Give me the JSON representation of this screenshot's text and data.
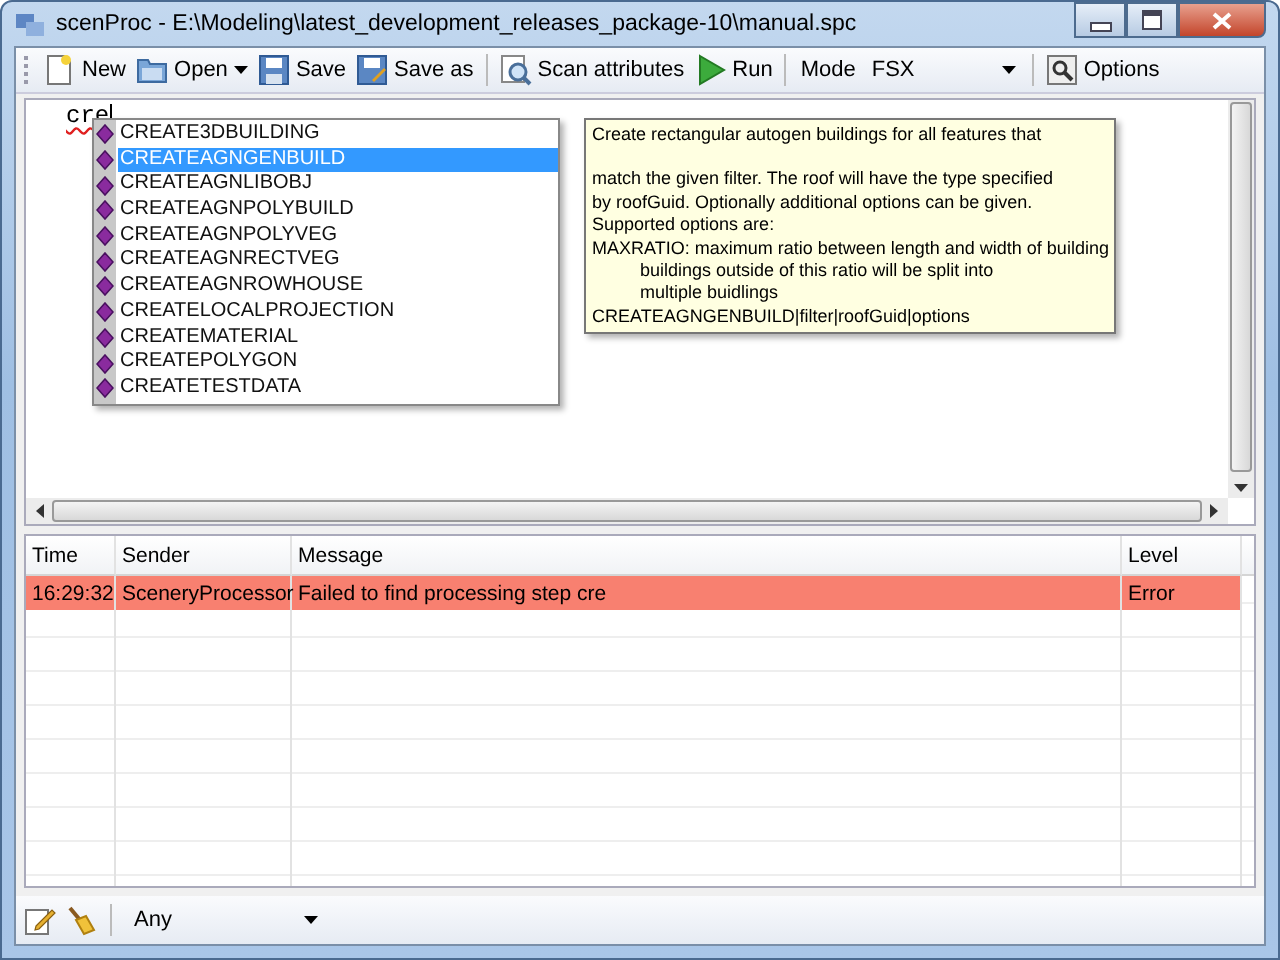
{
  "window": {
    "title": "scenProc - E:\\Modeling\\latest_development_releases_package-10\\manual.spc"
  },
  "toolbar": [
    {
      "kind": "button",
      "label": "New"
    },
    {
      "kind": "split",
      "label": "Open"
    },
    {
      "kind": "button",
      "label": "Save"
    },
    {
      "kind": "button",
      "label": "Save as"
    },
    {
      "kind": "separator"
    },
    {
      "kind": "button",
      "label": "Scan attributes"
    },
    {
      "kind": "button",
      "label": "Run"
    },
    {
      "kind": "separator"
    },
    {
      "kind": "label",
      "label": "Mode"
    },
    {
      "kind": "combo",
      "label": "FSX"
    },
    {
      "kind": "separator"
    },
    {
      "kind": "button",
      "label": "Options"
    }
  ],
  "editor": {
    "text": "cre",
    "completion": [
      {
        "label": "CREATE3DBUILDING",
        "selected": false
      },
      {
        "label": "CREATEAGNGENBUILD",
        "selected": true
      },
      {
        "label": "CREATEAGNLIBOBJ",
        "selected": false
      },
      {
        "label": "CREATEAGNPOLYBUILD",
        "selected": false
      },
      {
        "label": "CREATEAGNPOLYVEG",
        "selected": false
      },
      {
        "label": "CREATEAGNRECTVEG",
        "selected": false
      },
      {
        "label": "CREATEAGNROWHOUSE",
        "selected": false
      },
      {
        "label": "CREATELOCALPROJECTION",
        "selected": false
      },
      {
        "label": "CREATEMATERIAL",
        "selected": false
      },
      {
        "label": "CREATEPOLYGON",
        "selected": false
      },
      {
        "label": "CREATETESTDATA",
        "selected": false
      }
    ],
    "tooltip": {
      "heading": "Create rectangular autogen buildings for all features that",
      "lines": [
        {
          "text": "match the given filter. The roof will have the type specified"
        },
        {
          "text": "by roofGuid. Optionally additional options can be given."
        },
        {
          "text": "Supported options are:"
        },
        {
          "text": "MAXRATIO: maximum ratio between length and width of building",
          "children": [
            {
              "text": "buildings outside of this ratio will be split into"
            },
            {
              "text": "multiple buidlings"
            }
          ]
        },
        {
          "text": "CREATEAGNGENBUILD|filter|roofGuid|options"
        }
      ]
    }
  },
  "log": {
    "columns": [
      "Time",
      "Sender",
      "Message",
      "Level"
    ],
    "rows": [
      {
        "color": "#f88070",
        "cells": [
          "16:29:32",
          "SceneryProcessor",
          "Failed to find processing step cre",
          "Error"
        ]
      }
    ]
  },
  "filter": {
    "value": "Any"
  }
}
